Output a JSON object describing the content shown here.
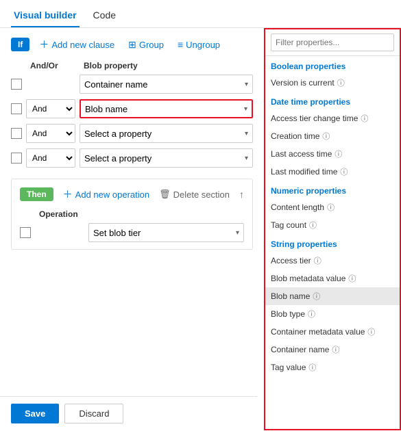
{
  "tabs": [
    {
      "label": "Visual builder",
      "active": true
    },
    {
      "label": "Code",
      "active": false
    }
  ],
  "if_section": {
    "badge": "If",
    "add_clause_label": "Add new clause",
    "group_label": "Group",
    "ungroup_label": "Ungroup",
    "column_headers": {
      "and_or": "And/Or",
      "blob_property": "Blob property"
    },
    "rows": [
      {
        "id": "row1",
        "and_or": null,
        "property": "Container name",
        "highlighted": false
      },
      {
        "id": "row2",
        "and_or": "And",
        "property": "Blob name",
        "highlighted": true
      },
      {
        "id": "row3",
        "and_or": "And",
        "property": "Select a property",
        "highlighted": false
      },
      {
        "id": "row4",
        "and_or": "And",
        "property": "Select a property",
        "highlighted": false
      }
    ]
  },
  "then_section": {
    "badge": "Then",
    "add_operation_label": "Add new operation",
    "delete_section_label": "Delete section",
    "column_headers": {
      "operation": "Operation"
    },
    "rows": [
      {
        "id": "op-row1",
        "operation": "Set blob tier"
      }
    ]
  },
  "bottom_bar": {
    "save_label": "Save",
    "discard_label": "Discard"
  },
  "right_panel": {
    "filter_placeholder": "Filter properties...",
    "categories": [
      {
        "name": "Boolean properties",
        "items": [
          {
            "label": "Version is current",
            "info": true
          }
        ]
      },
      {
        "name": "Date time properties",
        "items": [
          {
            "label": "Access tier change time",
            "info": true
          },
          {
            "label": "Creation time",
            "info": true
          },
          {
            "label": "Last access time",
            "info": true
          },
          {
            "label": "Last modified time",
            "info": true
          }
        ]
      },
      {
        "name": "Numeric properties",
        "items": [
          {
            "label": "Content length",
            "info": true
          },
          {
            "label": "Tag count",
            "info": true
          }
        ]
      },
      {
        "name": "String properties",
        "items": [
          {
            "label": "Access tier",
            "info": true
          },
          {
            "label": "Blob metadata value",
            "info": true
          },
          {
            "label": "Blob name",
            "info": true,
            "selected": true
          },
          {
            "label": "Blob type",
            "info": true
          },
          {
            "label": "Container metadata value",
            "info": true
          },
          {
            "label": "Container name",
            "info": true
          },
          {
            "label": "Tag value",
            "info": true
          }
        ]
      }
    ]
  }
}
